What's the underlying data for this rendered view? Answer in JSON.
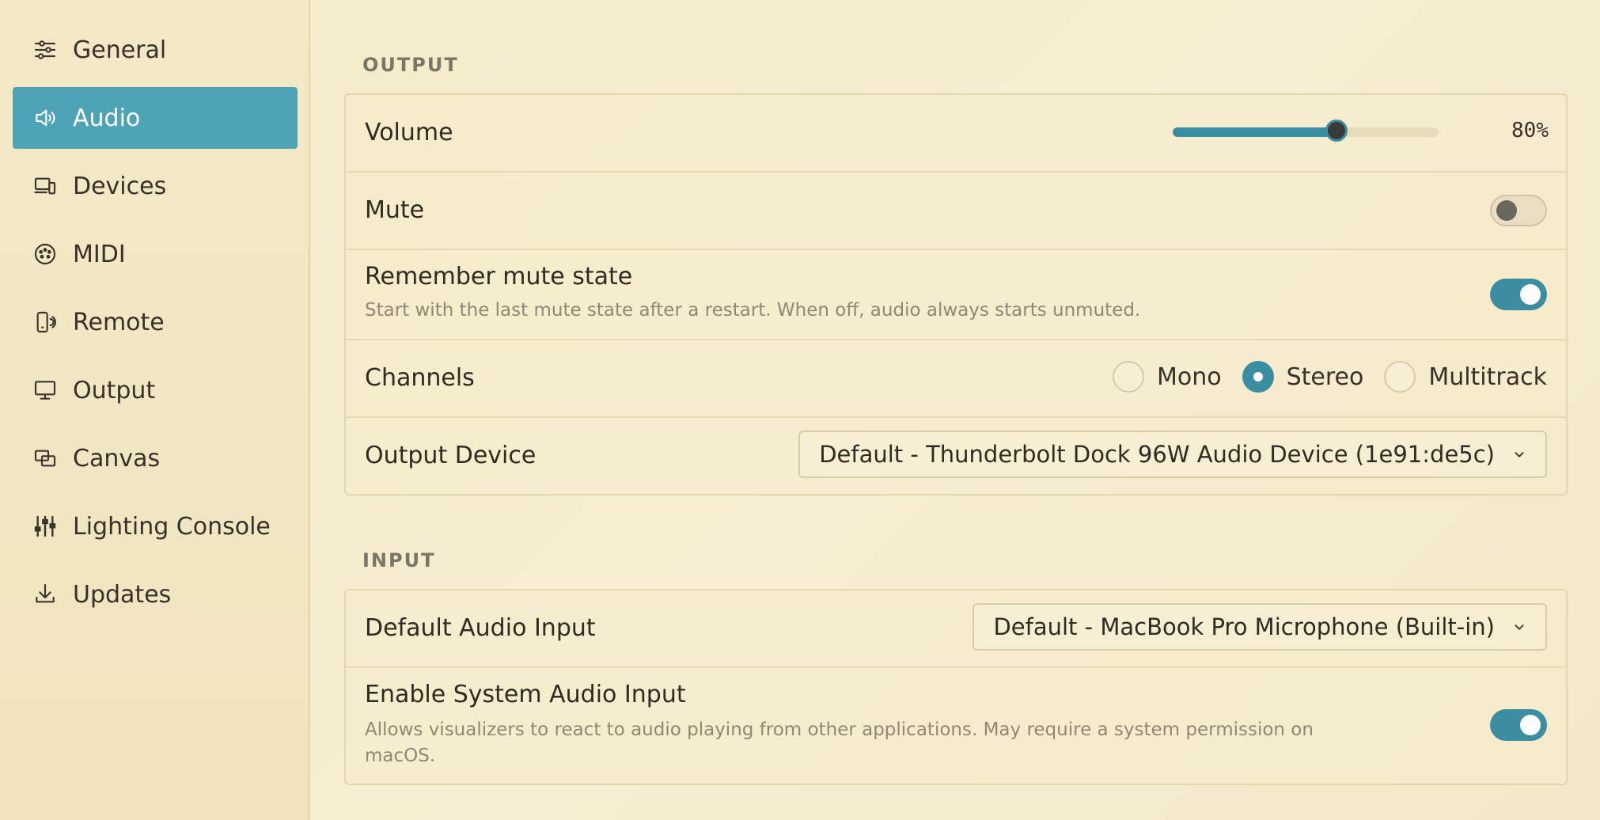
{
  "sidebar": {
    "items": [
      {
        "label": "General",
        "icon": "sliders-icon",
        "active": false
      },
      {
        "label": "Audio",
        "icon": "speaker-icon",
        "active": true
      },
      {
        "label": "Devices",
        "icon": "devices-icon",
        "active": false
      },
      {
        "label": "MIDI",
        "icon": "midi-connector-icon",
        "active": false
      },
      {
        "label": "Remote",
        "icon": "remote-phone-icon",
        "active": false
      },
      {
        "label": "Output",
        "icon": "monitor-icon",
        "active": false
      },
      {
        "label": "Canvas",
        "icon": "canvas-icon",
        "active": false
      },
      {
        "label": "Lighting Console",
        "icon": "faders-icon",
        "active": false
      },
      {
        "label": "Updates",
        "icon": "download-icon",
        "active": false
      }
    ]
  },
  "output": {
    "section_title": "OUTPUT",
    "volume": {
      "label": "Volume",
      "value": 80,
      "value_text": "80%"
    },
    "mute": {
      "label": "Mute",
      "enabled": false
    },
    "remember_mute": {
      "label": "Remember mute state",
      "description": "Start with the last mute state after a restart. When off, audio always starts unmuted.",
      "enabled": true
    },
    "channels": {
      "label": "Channels",
      "options": [
        "Mono",
        "Stereo",
        "Multitrack"
      ],
      "selected": "Stereo"
    },
    "output_device": {
      "label": "Output Device",
      "value": "Default - Thunderbolt Dock 96W Audio Device (1e91:de5c)"
    }
  },
  "input": {
    "section_title": "INPUT",
    "default_input": {
      "label": "Default Audio Input",
      "value": "Default - MacBook Pro Microphone (Built-in)"
    },
    "system_audio": {
      "label": "Enable System Audio Input",
      "description_line1": "Allows visualizers to react to audio playing from other applications. May require a system permission on",
      "description_line2": "macOS.",
      "enabled": true
    }
  },
  "colors": {
    "accent": "#3b8ea2",
    "sidebar_active": "#4ea3b7",
    "background": "#f4ebc9"
  }
}
